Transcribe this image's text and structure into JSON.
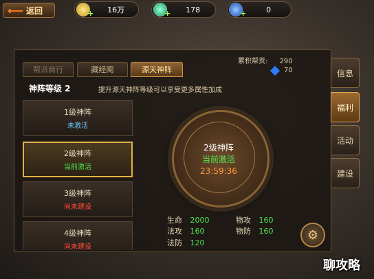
{
  "topbar": {
    "back_label": "返回",
    "gold": "16万",
    "jade": "178",
    "gem": "0",
    "colors": {
      "gold": "#d9b43a",
      "jade": "#2bd39a",
      "gem": "#2b7cff"
    }
  },
  "tabs": [
    {
      "label": "帮派商行"
    },
    {
      "label": "藏经阁"
    },
    {
      "label": "源天神阵"
    }
  ],
  "contribution": {
    "label": "累积帮贡:",
    "value": "290",
    "gem_value": "70"
  },
  "side_tabs": [
    {
      "label": "信息"
    },
    {
      "label": "福利"
    },
    {
      "label": "活动"
    },
    {
      "label": "建设"
    }
  ],
  "formation": {
    "level_title": "神阵等级 2",
    "description": "提升源天神阵等级可以享受更多属性加成"
  },
  "cards": [
    {
      "name": "1级神阵",
      "status": "未激活",
      "status_color": "#6cc8ff"
    },
    {
      "name": "2级神阵",
      "status": "当前激活",
      "status_color": "#4fe24f"
    },
    {
      "name": "3级神阵",
      "status": "尚未建设",
      "status_color": "#ff4a3a"
    },
    {
      "name": "4级神阵",
      "status": "尚未建设",
      "status_color": "#ff4a3a"
    }
  ],
  "seal": {
    "name": "2级神阵",
    "status": "当前激活",
    "timer": "23:59:36"
  },
  "stats": [
    {
      "label": "生命",
      "value": "2000"
    },
    {
      "label": "物攻",
      "value": "160"
    },
    {
      "label": "法攻",
      "value": "160"
    },
    {
      "label": "物防",
      "value": "160"
    },
    {
      "label": "法防",
      "value": "120"
    }
  ],
  "watermark": "聊攻略"
}
